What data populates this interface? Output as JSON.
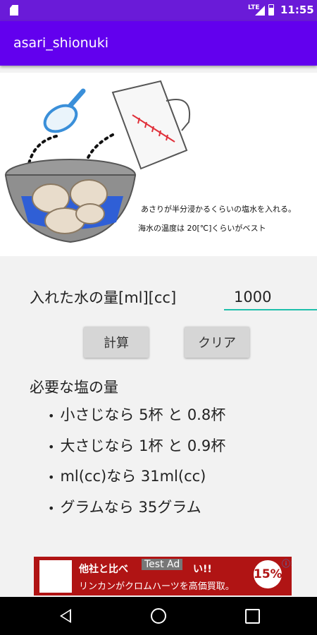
{
  "status_bar": {
    "network_label": "LTE",
    "time": "11:55",
    "icons": [
      "sd-card-icon",
      "signal-icon",
      "battery-icon"
    ]
  },
  "app_bar": {
    "title": "asari_shionuki"
  },
  "illustration": {
    "icons": [
      "measuring-spoon-icon",
      "measuring-cup-icon",
      "bowl-with-clams-icon"
    ],
    "caption_line1": "あさりが半分浸かるくらいの塩水を入れる。",
    "caption_line2": "海水の温度は 20[℃]くらいがベスト"
  },
  "form": {
    "water_label": "入れた水の量[ml][cc]",
    "water_value": "1000",
    "calc_button": "計算",
    "clear_button": "クリア"
  },
  "result": {
    "title": "必要な塩の量",
    "items": [
      "小さじなら 5杯 と 0.8杯",
      "大さじなら 1杯 と 0.9杯",
      "ml(cc)なら 31ml(cc)",
      "グラムなら 35グラム"
    ]
  },
  "ad": {
    "test_label": "Test Ad",
    "line1": "他社と比べ",
    "line1_end": "い!!",
    "line2": "リンカンがクロムハーツを高価買取。",
    "badge": "15%",
    "icons": [
      "ad-logo-icon",
      "ad-info-icon",
      "ad-close-icon"
    ]
  },
  "colors": {
    "status_bar": "#6a1bd8",
    "app_bar": "#6200ee",
    "input_underline": "#1fbfab",
    "ad_background": "#b01414"
  }
}
